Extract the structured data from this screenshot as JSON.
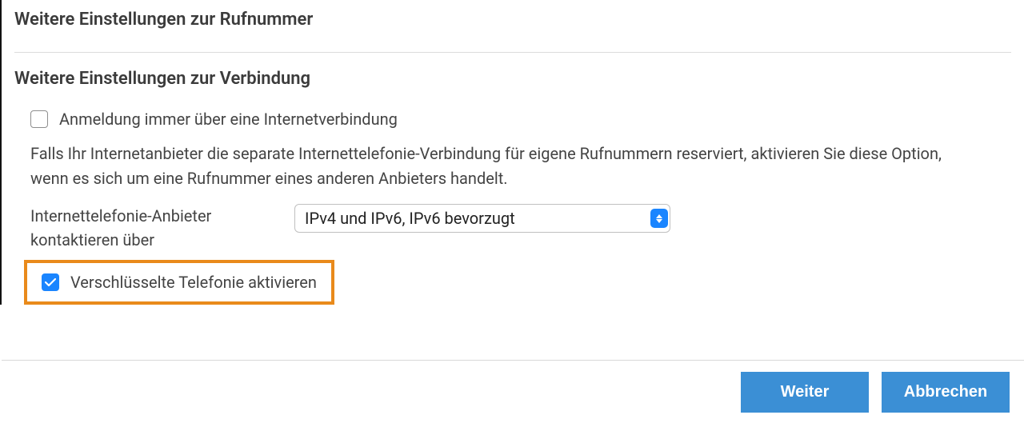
{
  "section1": {
    "title": "Weitere Einstellungen zur Rufnummer"
  },
  "section2": {
    "title": "Weitere Einstellungen zur Verbindung",
    "login_via_internet": {
      "checked": false,
      "label": "Anmeldung immer über eine Internetverbindung"
    },
    "description": "Falls Ihr Internetanbieter die separate Internettelefonie-Verbindung für eigene Rufnummern reserviert, aktivieren Sie diese Option, wenn es sich um eine Rufnummer eines anderen Anbieters handelt.",
    "contact_via": {
      "label": "Internettelefonie-Anbieter kontaktieren über",
      "selected": "IPv4 und IPv6, IPv6 bevorzugt"
    },
    "encrypted_telephony": {
      "checked": true,
      "label": "Verschlüsselte Telefonie aktivieren"
    }
  },
  "footer": {
    "continue": "Weiter",
    "cancel": "Abbrechen"
  }
}
